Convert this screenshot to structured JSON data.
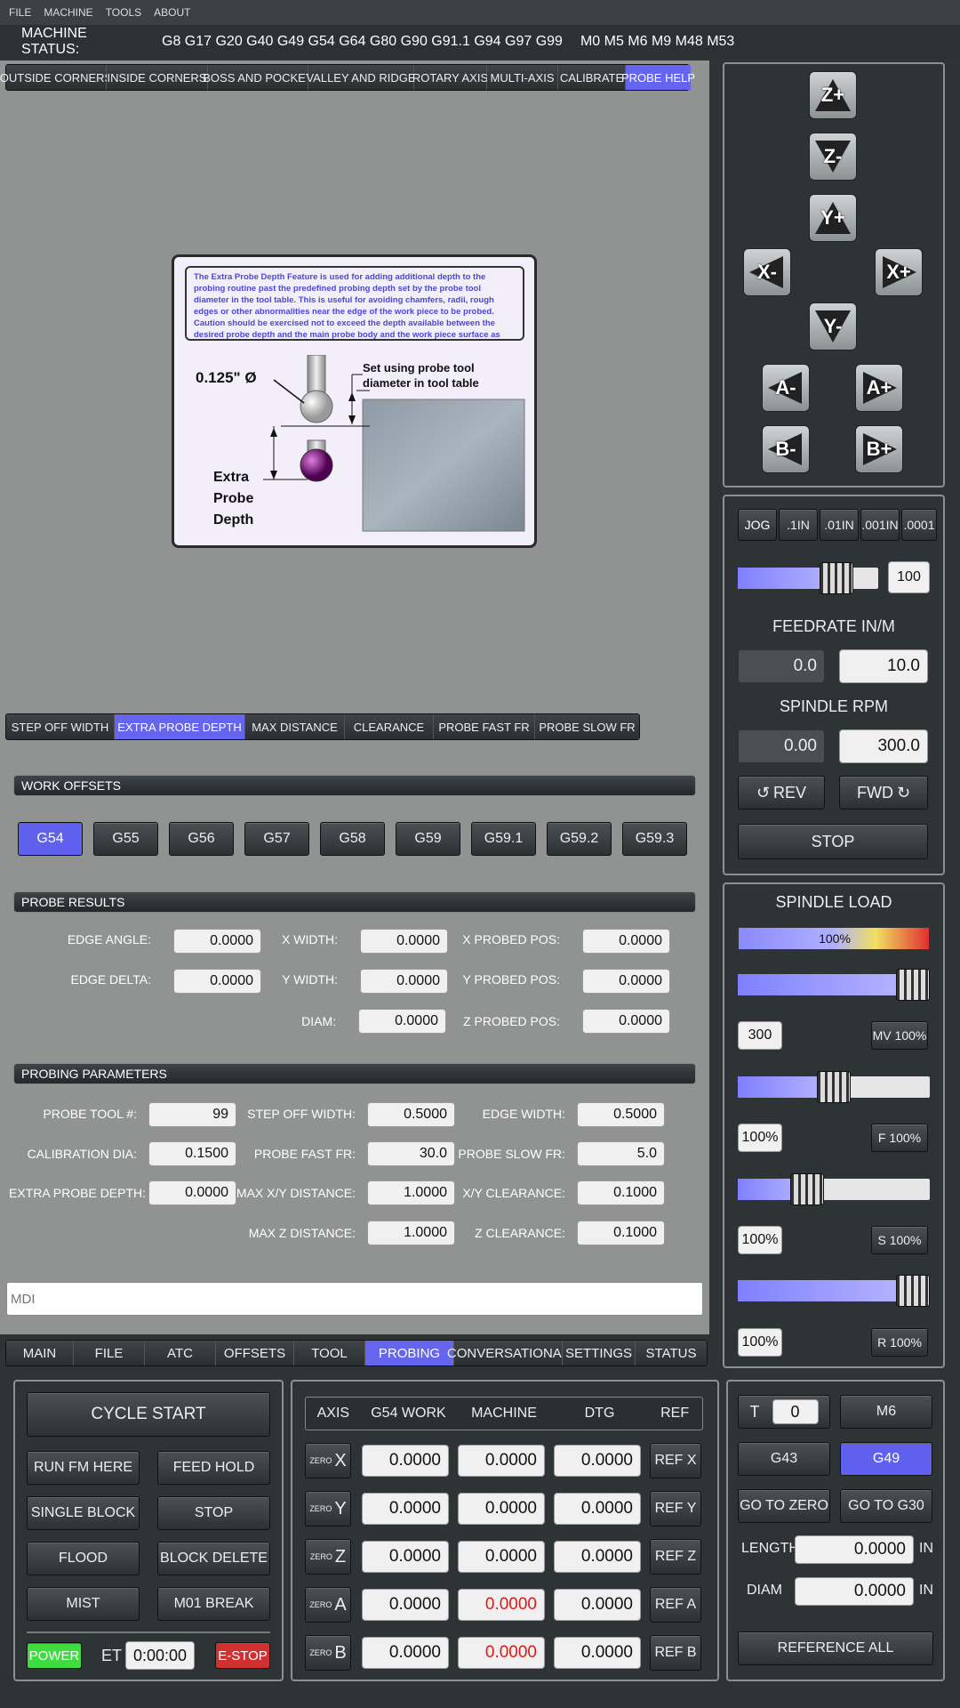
{
  "menu": [
    "FILE",
    "MACHINE",
    "TOOLS",
    "ABOUT"
  ],
  "status": {
    "label": "MACHINE STATUS:",
    "gcodes": "G8 G17 G20 G40 G49 G54 G64 G80 G90 G91.1 G94 G97 G99",
    "mcodes": "M0 M5 M6 M9 M48 M53"
  },
  "probe_tabs": [
    "OUTSIDE CORNERS",
    "INSIDE CORNERS",
    "BOSS AND POCKET",
    "VALLEY AND RIDGE",
    "ROTARY AXIS",
    "MULTI-AXIS",
    "CALIBRATE",
    "PROBE HELP"
  ],
  "help": {
    "text": "The Extra Probe Depth Feature is used for adding additional depth to the probing routine past the predefined probing depth set by the probe tool diameter in the tool table.  This is useful for avoiding chamfers, radii, rough edges or other abnormalities near the edge of the work piece to be probed.  Caution should be exercised not to exceed the depth available between the desired probe depth and the main probe body and the work piece surface as this will result in a crash.",
    "diameter": "0.125\" Ø",
    "set_note_1": "Set using probe tool",
    "set_note_2": "diameter in tool table",
    "extra_1": "Extra",
    "extra_2": "Probe",
    "extra_3": "Depth"
  },
  "help_tabs": [
    "STEP OFF WIDTH",
    "EXTRA PROBE DEPTH",
    "MAX DISTANCE",
    "CLEARANCE",
    "PROBE FAST FR",
    "PROBE SLOW FR"
  ],
  "work_offsets": {
    "title": "WORK OFFSETS",
    "items": [
      "G54",
      "G55",
      "G56",
      "G57",
      "G58",
      "G59",
      "G59.1",
      "G59.2",
      "G59.3"
    ]
  },
  "probe_results": {
    "title": "PROBE RESULTS",
    "edge_angle": {
      "label": "EDGE ANGLE:",
      "value": "0.0000"
    },
    "edge_delta": {
      "label": "EDGE DELTA:",
      "value": "0.0000"
    },
    "x_width": {
      "label": "X WIDTH:",
      "value": "0.0000"
    },
    "y_width": {
      "label": "Y WIDTH:",
      "value": "0.0000"
    },
    "diam": {
      "label": "DIAM:",
      "value": "0.0000"
    },
    "x_probed": {
      "label": "X PROBED POS:",
      "value": "0.0000"
    },
    "y_probed": {
      "label": "Y PROBED POS:",
      "value": "0.0000"
    },
    "z_probed": {
      "label": "Z PROBED POS:",
      "value": "0.0000"
    }
  },
  "params": {
    "title": "PROBING PARAMETERS",
    "probe_tool": {
      "label": "PROBE TOOL #:",
      "value": "99"
    },
    "cal_dia": {
      "label": "CALIBRATION DIA:",
      "value": "0.1500"
    },
    "extra_depth": {
      "label": "EXTRA PROBE DEPTH:",
      "value": "0.0000"
    },
    "step_off": {
      "label": "STEP OFF WIDTH:",
      "value": "0.5000"
    },
    "fast_fr": {
      "label": "PROBE FAST FR:",
      "value": "30.0"
    },
    "max_xy": {
      "label": "MAX X/Y DISTANCE:",
      "value": "1.0000"
    },
    "max_z": {
      "label": "MAX Z DISTANCE:",
      "value": "1.0000"
    },
    "edge_width": {
      "label": "EDGE WIDTH:",
      "value": "0.5000"
    },
    "slow_fr": {
      "label": "PROBE SLOW FR:",
      "value": "5.0"
    },
    "xy_clear": {
      "label": "X/Y CLEARANCE:",
      "value": "0.1000"
    },
    "z_clear": {
      "label": "Z CLEARANCE:",
      "value": "0.1000"
    }
  },
  "mdi": {
    "placeholder": "MDI"
  },
  "main_tabs": [
    "MAIN",
    "FILE",
    "ATC",
    "OFFSETS",
    "TOOL",
    "PROBING",
    "CONVERSATIONAL",
    "SETTINGS",
    "STATUS"
  ],
  "jog": {
    "zp": "Z+",
    "zm": "Z-",
    "yp": "Y+",
    "ym": "Y-",
    "xm": "X-",
    "xp": "X+",
    "am": "A-",
    "ap": "A+",
    "bm": "B-",
    "bp": "B+"
  },
  "jog_steps": [
    "JOG",
    ".1IN",
    ".01IN",
    ".001IN",
    ".0001"
  ],
  "jog_rate": "100",
  "feedrate": {
    "title": "FEEDRATE IN/M",
    "actual": "0.0",
    "set": "10.0"
  },
  "spindle": {
    "title": "SPINDLE RPM",
    "actual": "0.00",
    "set": "300.0",
    "rev": "REV",
    "fwd": "FWD",
    "stop": "STOP"
  },
  "spindle_load": {
    "title": "SPINDLE LOAD",
    "percent": "100%",
    "load_fraction": 1.0,
    "rows": [
      {
        "value": "300",
        "btn": "MV 100%",
        "level": 0.93
      },
      {
        "value": "100%",
        "btn": "F 100%",
        "level": 0.5
      },
      {
        "value": "100%",
        "btn": "S 100%",
        "level": 0.36
      },
      {
        "value": "100%",
        "btn": "R 100%",
        "level": 0.93
      }
    ]
  },
  "cycle": {
    "start": "CYCLE START",
    "run_fm": "RUN FM HERE",
    "feed_hold": "FEED HOLD",
    "single": "SINGLE BLOCK",
    "stop": "STOP",
    "flood": "FLOOD",
    "block_delete": "BLOCK DELETE",
    "mist": "MIST",
    "m01": "M01 BREAK",
    "power": "POWER",
    "et_label": "ET",
    "et": "0:00:00",
    "estop": "E-STOP"
  },
  "dro": {
    "headers": [
      "AXIS",
      "G54 WORK",
      "MACHINE",
      "DTG",
      "REF"
    ],
    "zero": "ZERO",
    "rows": [
      {
        "axis": "X",
        "work": "0.0000",
        "machine": "0.0000",
        "dtg": "0.0000",
        "ref": "REF X",
        "red": false
      },
      {
        "axis": "Y",
        "work": "0.0000",
        "machine": "0.0000",
        "dtg": "0.0000",
        "ref": "REF Y",
        "red": false
      },
      {
        "axis": "Z",
        "work": "0.0000",
        "machine": "0.0000",
        "dtg": "0.0000",
        "ref": "REF Z",
        "red": false
      },
      {
        "axis": "A",
        "work": "0.0000",
        "machine": "0.0000",
        "dtg": "0.0000",
        "ref": "REF A",
        "red": true
      },
      {
        "axis": "B",
        "work": "0.0000",
        "machine": "0.0000",
        "dtg": "0.0000",
        "ref": "REF B",
        "red": true
      }
    ]
  },
  "tool": {
    "t_label": "T",
    "t_value": "0",
    "m6": "M6",
    "g43": "G43",
    "g49": "G49",
    "go_zero": "GO TO ZERO",
    "go_g30": "GO TO G30",
    "length_label": "LENGTH",
    "length": "0.0000",
    "diam_label": "DIAM",
    "diam": "0.0000",
    "unit": "IN",
    "ref_all": "REFERENCE ALL"
  }
}
